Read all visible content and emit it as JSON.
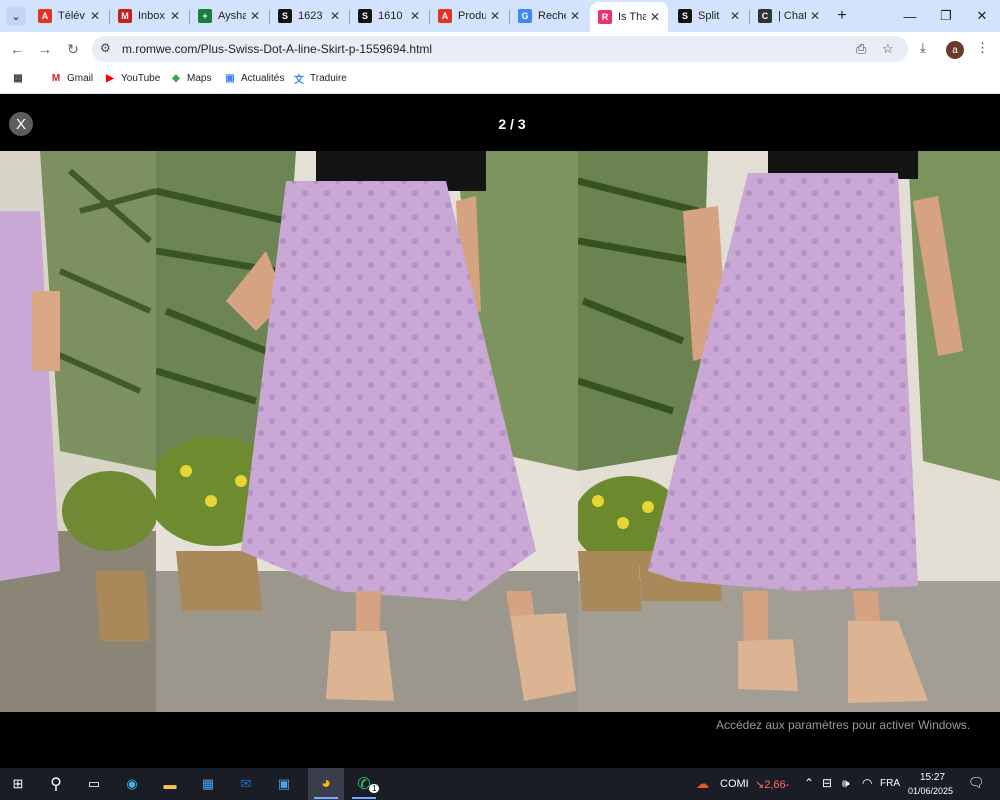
{
  "browser": {
    "tabs": [
      {
        "label": "Télév",
        "favicon": "ali-icon",
        "color": "#e43225",
        "glyph": "A"
      },
      {
        "label": "Inbox",
        "favicon": "gmail-icon",
        "color": "#c5221f",
        "glyph": "M"
      },
      {
        "label": "Aysha",
        "favicon": "sheets-icon",
        "color": "#188038",
        "glyph": "+"
      },
      {
        "label": "1623",
        "favicon": "s-icon",
        "color": "#111111",
        "glyph": "S"
      },
      {
        "label": "1610",
        "favicon": "s-icon",
        "color": "#111111",
        "glyph": "S"
      },
      {
        "label": "Produ",
        "favicon": "ali-icon",
        "color": "#e43225",
        "glyph": "A"
      },
      {
        "label": "Reche",
        "favicon": "google-icon",
        "color": "#4285f4",
        "glyph": "G"
      },
      {
        "label": "Is Tha",
        "favicon": "romwe-icon",
        "color": "#e8336f",
        "glyph": "R",
        "active": true
      },
      {
        "label": "Split",
        "favicon": "s-icon",
        "color": "#111111",
        "glyph": "S"
      },
      {
        "label": "| Chat",
        "favicon": "c-icon",
        "color": "#333333",
        "glyph": "C"
      }
    ],
    "url": "m.romwe.com/Plus-Swiss-Dot-A-line-Skirt-p-1559694.html",
    "bookmarks": [
      {
        "label": "Gmail",
        "icon": "gmail-icon",
        "color": "#c5221f",
        "glyph": "M"
      },
      {
        "label": "YouTube",
        "icon": "youtube-icon",
        "color": "#ff0000",
        "glyph": "▶"
      },
      {
        "label": "Maps",
        "icon": "maps-icon",
        "color": "#34a853",
        "glyph": "◆"
      },
      {
        "label": "Actualités",
        "icon": "news-icon",
        "color": "#4285f4",
        "glyph": "▣"
      },
      {
        "label": "Traduire",
        "icon": "translate-icon",
        "color": "#4285f4",
        "glyph": "文"
      }
    ],
    "profile_initial": "a"
  },
  "viewer": {
    "close_label": "X",
    "counter": "2 / 3",
    "activate_notice": "Accédez aux paramètres pour activer Windows.",
    "skirt_color": "#c9a8d6"
  },
  "taskbar": {
    "weather_label": "COMI",
    "stock_change": "↘2,66-",
    "language": "FRA",
    "time": "15:27",
    "date": "01/06/2025",
    "whatsapp_badge": "1"
  }
}
